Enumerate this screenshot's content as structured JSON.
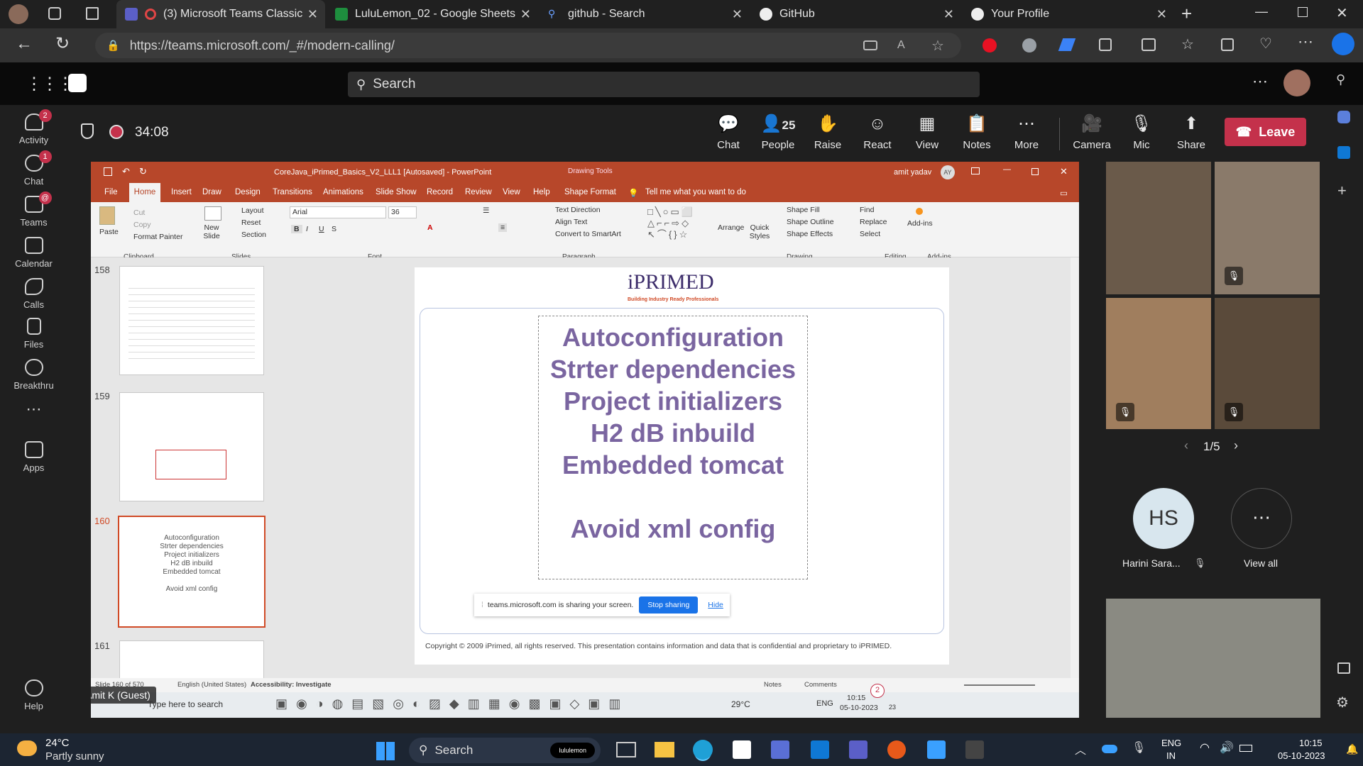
{
  "browser": {
    "tabs": [
      {
        "title": "(3) Microsoft Teams Classic",
        "icon": "teams-icon"
      },
      {
        "title": "LuluLemon_02 - Google Sheets",
        "icon": "sheets-icon"
      },
      {
        "title": "github - Search",
        "icon": "search-icon"
      },
      {
        "title": "GitHub",
        "icon": "github-icon"
      },
      {
        "title": "Your Profile",
        "icon": "github-icon"
      }
    ],
    "url": "https://teams.microsoft.com/_#/modern-calling/"
  },
  "teams": {
    "search_placeholder": "Search",
    "rail": [
      {
        "label": "Activity",
        "badge": "2",
        "icon": "bell-icon"
      },
      {
        "label": "Chat",
        "badge": "1",
        "icon": "chat-icon"
      },
      {
        "label": "Teams",
        "badge": "@",
        "icon": "teams-icon"
      },
      {
        "label": "Calendar",
        "badge": "",
        "icon": "calendar-icon"
      },
      {
        "label": "Calls",
        "badge": "",
        "icon": "phone-icon"
      },
      {
        "label": "Files",
        "badge": "",
        "icon": "file-icon"
      },
      {
        "label": "Breakthru",
        "badge": "",
        "icon": "breakthru-icon"
      },
      {
        "label": "Apps",
        "badge": "",
        "icon": "apps-icon"
      },
      {
        "label": "Help",
        "badge": "",
        "icon": "help-icon"
      }
    ],
    "meeting": {
      "timer": "34:08",
      "people_count": "25",
      "buttons": [
        "Chat",
        "People",
        "Raise",
        "React",
        "View",
        "Notes",
        "More",
        "Camera",
        "Mic",
        "Share"
      ],
      "leave": "Leave"
    },
    "presenter_label": "Amit K (Guest)",
    "pagination": "1/5",
    "participant": {
      "initials": "HS",
      "name": "Harini Sara..."
    },
    "view_all": "View all"
  },
  "ppt": {
    "title": "CoreJava_iPrimed_Basics_V2_LLL1 [Autosaved]  -  PowerPoint",
    "drawing_tools": "Drawing Tools",
    "user": "amit yadav",
    "user_initials": "AY",
    "tabs": [
      "File",
      "Home",
      "Insert",
      "Draw",
      "Design",
      "Transitions",
      "Animations",
      "Slide Show",
      "Record",
      "Review",
      "View",
      "Help",
      "Shape Format"
    ],
    "tell_me": "Tell me what you want to do",
    "font": "Arial",
    "font_size": "36",
    "ribbon_labels": {
      "paste": "Paste",
      "cut": "Cut",
      "copy": "Copy",
      "format_painter": "Format Painter",
      "new_slide": "New Slide",
      "layout": "Layout",
      "reset": "Reset",
      "section": "Section",
      "text_direction": "Text Direction",
      "align_text": "Align Text",
      "convert_smartart": "Convert to SmartArt",
      "arrange": "Arrange",
      "quick_styles": "Quick Styles",
      "shape_fill": "Shape Fill",
      "shape_outline": "Shape Outline",
      "shape_effects": "Shape Effects",
      "find": "Find",
      "replace": "Replace",
      "select": "Select",
      "addins": "Add-ins"
    },
    "groups": [
      "Clipboard",
      "Slides",
      "Font",
      "Paragraph",
      "Drawing",
      "Editing",
      "Add-ins"
    ],
    "thumbnails": [
      "158",
      "159",
      "160",
      "161"
    ],
    "slide_lines": [
      "Autoconfiguration",
      "Strter dependencies",
      "Project initializers",
      "H2 dB inbuild",
      "Embedded tomcat",
      "",
      "Avoid xml config"
    ],
    "logo": "iPRIMED",
    "logo_tagline": "Building Industry Ready Professionals",
    "sharing_msg": "teams.microsoft.com is sharing your screen.",
    "stop_sharing": "Stop sharing",
    "hide": "Hide",
    "copyright": "Copyright © 2009 iPrimed, all rights reserved. This presentation contains information  and data  that is confidential and proprietary to iPRIMED.",
    "status": {
      "slide": "Slide 160 of 570",
      "lang": "English (United States)",
      "accessibility": "Accessibility: Investigate",
      "notes": "Notes",
      "comments": "Comments"
    },
    "inner_task": {
      "search": "Type here to search",
      "temp": "29°C",
      "lang": "ENG",
      "time": "10:15",
      "date": "05-10-2023",
      "notif": "23",
      "counter": "2"
    }
  },
  "taskbar": {
    "weather_temp": "24°C",
    "weather_desc": "Partly sunny",
    "search": "Search",
    "pill": "lululemon",
    "lang1": "ENG",
    "lang2": "IN",
    "time": "10:15",
    "date": "05-10-2023"
  }
}
